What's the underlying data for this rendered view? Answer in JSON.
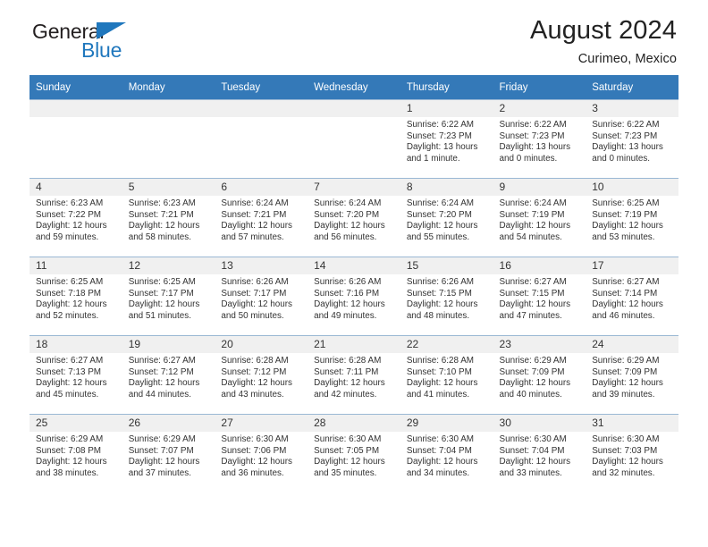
{
  "brand": {
    "name_part1": "General",
    "name_part2": "Blue",
    "colors": {
      "blue": "#1f77bd",
      "dark": "#231f20"
    }
  },
  "header": {
    "title": "August 2024",
    "subtitle": "Curimeo, Mexico"
  },
  "theme": {
    "header_row_bg": "#3479b8",
    "daynum_bg": "#f0f0f0",
    "grid_line": "#9ab8d4"
  },
  "weekdays": [
    "Sunday",
    "Monday",
    "Tuesday",
    "Wednesday",
    "Thursday",
    "Friday",
    "Saturday"
  ],
  "weeks": [
    [
      {
        "day": "",
        "sunrise": "",
        "sunset": "",
        "daylight1": "",
        "daylight2": ""
      },
      {
        "day": "",
        "sunrise": "",
        "sunset": "",
        "daylight1": "",
        "daylight2": ""
      },
      {
        "day": "",
        "sunrise": "",
        "sunset": "",
        "daylight1": "",
        "daylight2": ""
      },
      {
        "day": "",
        "sunrise": "",
        "sunset": "",
        "daylight1": "",
        "daylight2": ""
      },
      {
        "day": "1",
        "sunrise": "Sunrise: 6:22 AM",
        "sunset": "Sunset: 7:23 PM",
        "daylight1": "Daylight: 13 hours",
        "daylight2": "and 1 minute."
      },
      {
        "day": "2",
        "sunrise": "Sunrise: 6:22 AM",
        "sunset": "Sunset: 7:23 PM",
        "daylight1": "Daylight: 13 hours",
        "daylight2": "and 0 minutes."
      },
      {
        "day": "3",
        "sunrise": "Sunrise: 6:22 AM",
        "sunset": "Sunset: 7:23 PM",
        "daylight1": "Daylight: 13 hours",
        "daylight2": "and 0 minutes."
      }
    ],
    [
      {
        "day": "4",
        "sunrise": "Sunrise: 6:23 AM",
        "sunset": "Sunset: 7:22 PM",
        "daylight1": "Daylight: 12 hours",
        "daylight2": "and 59 minutes."
      },
      {
        "day": "5",
        "sunrise": "Sunrise: 6:23 AM",
        "sunset": "Sunset: 7:21 PM",
        "daylight1": "Daylight: 12 hours",
        "daylight2": "and 58 minutes."
      },
      {
        "day": "6",
        "sunrise": "Sunrise: 6:24 AM",
        "sunset": "Sunset: 7:21 PM",
        "daylight1": "Daylight: 12 hours",
        "daylight2": "and 57 minutes."
      },
      {
        "day": "7",
        "sunrise": "Sunrise: 6:24 AM",
        "sunset": "Sunset: 7:20 PM",
        "daylight1": "Daylight: 12 hours",
        "daylight2": "and 56 minutes."
      },
      {
        "day": "8",
        "sunrise": "Sunrise: 6:24 AM",
        "sunset": "Sunset: 7:20 PM",
        "daylight1": "Daylight: 12 hours",
        "daylight2": "and 55 minutes."
      },
      {
        "day": "9",
        "sunrise": "Sunrise: 6:24 AM",
        "sunset": "Sunset: 7:19 PM",
        "daylight1": "Daylight: 12 hours",
        "daylight2": "and 54 minutes."
      },
      {
        "day": "10",
        "sunrise": "Sunrise: 6:25 AM",
        "sunset": "Sunset: 7:19 PM",
        "daylight1": "Daylight: 12 hours",
        "daylight2": "and 53 minutes."
      }
    ],
    [
      {
        "day": "11",
        "sunrise": "Sunrise: 6:25 AM",
        "sunset": "Sunset: 7:18 PM",
        "daylight1": "Daylight: 12 hours",
        "daylight2": "and 52 minutes."
      },
      {
        "day": "12",
        "sunrise": "Sunrise: 6:25 AM",
        "sunset": "Sunset: 7:17 PM",
        "daylight1": "Daylight: 12 hours",
        "daylight2": "and 51 minutes."
      },
      {
        "day": "13",
        "sunrise": "Sunrise: 6:26 AM",
        "sunset": "Sunset: 7:17 PM",
        "daylight1": "Daylight: 12 hours",
        "daylight2": "and 50 minutes."
      },
      {
        "day": "14",
        "sunrise": "Sunrise: 6:26 AM",
        "sunset": "Sunset: 7:16 PM",
        "daylight1": "Daylight: 12 hours",
        "daylight2": "and 49 minutes."
      },
      {
        "day": "15",
        "sunrise": "Sunrise: 6:26 AM",
        "sunset": "Sunset: 7:15 PM",
        "daylight1": "Daylight: 12 hours",
        "daylight2": "and 48 minutes."
      },
      {
        "day": "16",
        "sunrise": "Sunrise: 6:27 AM",
        "sunset": "Sunset: 7:15 PM",
        "daylight1": "Daylight: 12 hours",
        "daylight2": "and 47 minutes."
      },
      {
        "day": "17",
        "sunrise": "Sunrise: 6:27 AM",
        "sunset": "Sunset: 7:14 PM",
        "daylight1": "Daylight: 12 hours",
        "daylight2": "and 46 minutes."
      }
    ],
    [
      {
        "day": "18",
        "sunrise": "Sunrise: 6:27 AM",
        "sunset": "Sunset: 7:13 PM",
        "daylight1": "Daylight: 12 hours",
        "daylight2": "and 45 minutes."
      },
      {
        "day": "19",
        "sunrise": "Sunrise: 6:27 AM",
        "sunset": "Sunset: 7:12 PM",
        "daylight1": "Daylight: 12 hours",
        "daylight2": "and 44 minutes."
      },
      {
        "day": "20",
        "sunrise": "Sunrise: 6:28 AM",
        "sunset": "Sunset: 7:12 PM",
        "daylight1": "Daylight: 12 hours",
        "daylight2": "and 43 minutes."
      },
      {
        "day": "21",
        "sunrise": "Sunrise: 6:28 AM",
        "sunset": "Sunset: 7:11 PM",
        "daylight1": "Daylight: 12 hours",
        "daylight2": "and 42 minutes."
      },
      {
        "day": "22",
        "sunrise": "Sunrise: 6:28 AM",
        "sunset": "Sunset: 7:10 PM",
        "daylight1": "Daylight: 12 hours",
        "daylight2": "and 41 minutes."
      },
      {
        "day": "23",
        "sunrise": "Sunrise: 6:29 AM",
        "sunset": "Sunset: 7:09 PM",
        "daylight1": "Daylight: 12 hours",
        "daylight2": "and 40 minutes."
      },
      {
        "day": "24",
        "sunrise": "Sunrise: 6:29 AM",
        "sunset": "Sunset: 7:09 PM",
        "daylight1": "Daylight: 12 hours",
        "daylight2": "and 39 minutes."
      }
    ],
    [
      {
        "day": "25",
        "sunrise": "Sunrise: 6:29 AM",
        "sunset": "Sunset: 7:08 PM",
        "daylight1": "Daylight: 12 hours",
        "daylight2": "and 38 minutes."
      },
      {
        "day": "26",
        "sunrise": "Sunrise: 6:29 AM",
        "sunset": "Sunset: 7:07 PM",
        "daylight1": "Daylight: 12 hours",
        "daylight2": "and 37 minutes."
      },
      {
        "day": "27",
        "sunrise": "Sunrise: 6:30 AM",
        "sunset": "Sunset: 7:06 PM",
        "daylight1": "Daylight: 12 hours",
        "daylight2": "and 36 minutes."
      },
      {
        "day": "28",
        "sunrise": "Sunrise: 6:30 AM",
        "sunset": "Sunset: 7:05 PM",
        "daylight1": "Daylight: 12 hours",
        "daylight2": "and 35 minutes."
      },
      {
        "day": "29",
        "sunrise": "Sunrise: 6:30 AM",
        "sunset": "Sunset: 7:04 PM",
        "daylight1": "Daylight: 12 hours",
        "daylight2": "and 34 minutes."
      },
      {
        "day": "30",
        "sunrise": "Sunrise: 6:30 AM",
        "sunset": "Sunset: 7:04 PM",
        "daylight1": "Daylight: 12 hours",
        "daylight2": "and 33 minutes."
      },
      {
        "day": "31",
        "sunrise": "Sunrise: 6:30 AM",
        "sunset": "Sunset: 7:03 PM",
        "daylight1": "Daylight: 12 hours",
        "daylight2": "and 32 minutes."
      }
    ]
  ]
}
